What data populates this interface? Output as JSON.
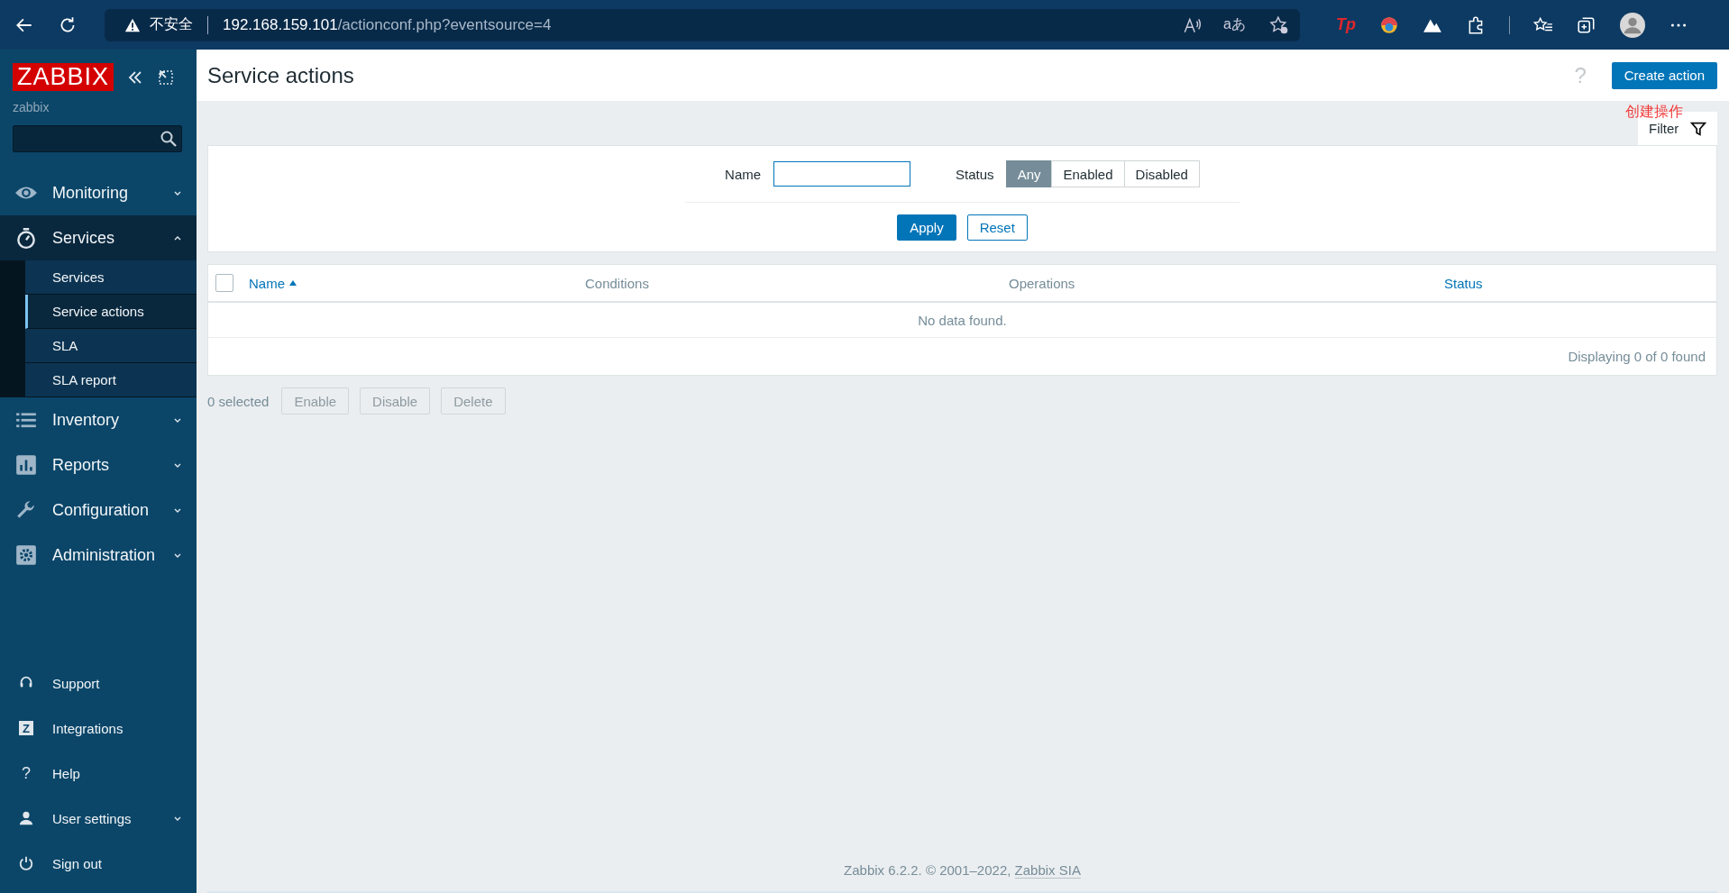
{
  "browser": {
    "security": "不安全",
    "host": "192.168.159.101",
    "path": "/actionconf.php?eventsource=4",
    "translate_glyph": "aあ",
    "extension_glyph": "Tp"
  },
  "sidebar": {
    "logo": "ZABBIX",
    "user": "zabbix",
    "menu": [
      {
        "label": "Monitoring",
        "kind": "eye",
        "expanded": false
      },
      {
        "label": "Services",
        "kind": "stopwatch",
        "expanded": true,
        "children": [
          {
            "label": "Services",
            "selected": false
          },
          {
            "label": "Service actions",
            "selected": true
          },
          {
            "label": "SLA",
            "selected": false
          },
          {
            "label": "SLA report",
            "selected": false
          }
        ]
      },
      {
        "label": "Inventory",
        "kind": "list",
        "expanded": false
      },
      {
        "label": "Reports",
        "kind": "chart",
        "expanded": false
      },
      {
        "label": "Configuration",
        "kind": "wrench",
        "expanded": false
      },
      {
        "label": "Administration",
        "kind": "gear",
        "expanded": false
      }
    ],
    "bottom": [
      {
        "label": "Support",
        "kind": "headset"
      },
      {
        "label": "Integrations",
        "kind": "glyphbox",
        "glyph": "Z"
      },
      {
        "label": "Help",
        "kind": "glyph",
        "glyph": "?"
      },
      {
        "label": "User settings",
        "kind": "user",
        "expanded": false
      },
      {
        "label": "Sign out",
        "kind": "power"
      }
    ]
  },
  "header": {
    "title": "Service actions",
    "help_glyph": "?",
    "create_button": "Create action",
    "annotation": "创建操作"
  },
  "filter": {
    "tab": "Filter",
    "name_label": "Name",
    "status_label": "Status",
    "status_options": [
      {
        "label": "Any",
        "selected": true
      },
      {
        "label": "Enabled",
        "selected": false
      },
      {
        "label": "Disabled",
        "selected": false
      }
    ],
    "apply": "Apply",
    "reset": "Reset"
  },
  "table": {
    "select_all_checked": false,
    "columns": [
      {
        "label": "Name",
        "link": true,
        "sorted": true
      },
      {
        "label": "Conditions",
        "link": false,
        "sorted": false
      },
      {
        "label": "Operations",
        "link": false,
        "sorted": false
      },
      {
        "label": "Status",
        "link": true,
        "sorted": false
      }
    ],
    "empty_message": "No data found.",
    "summary": "Displaying 0 of 0 found"
  },
  "actions": {
    "selected_count": "0 selected",
    "buttons": [
      {
        "label": "Enable",
        "disabled": true
      },
      {
        "label": "Disable",
        "disabled": true
      },
      {
        "label": "Delete",
        "disabled": true
      }
    ]
  },
  "footer": {
    "text": "Zabbix 6.2.2. © 2001–2022, ",
    "link": "Zabbix SIA"
  }
}
